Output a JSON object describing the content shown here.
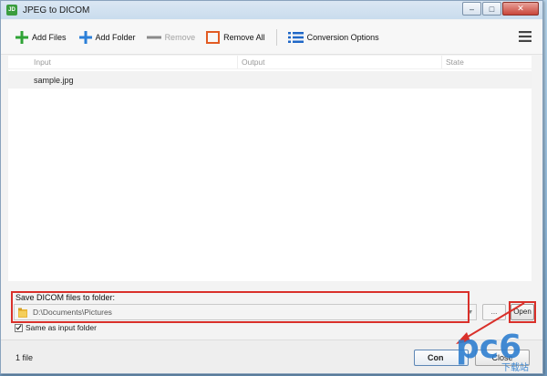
{
  "window": {
    "app_icon_text": "JD",
    "title": "JPEG to DICOM",
    "minimize_glyph": "–",
    "maximize_glyph": "□",
    "close_glyph": "✕"
  },
  "toolbar": {
    "add_files": "Add Files",
    "add_folder": "Add Folder",
    "remove": "Remove",
    "remove_all": "Remove All",
    "conversion_options": "Conversion Options",
    "colors": {
      "add_files_icon": "#2fa336",
      "add_folder_icon": "#2b7fd8",
      "remove_icon": "#8a8a8a",
      "remove_all_icon": "#e25b23",
      "options_icon": "#1f67c7"
    }
  },
  "file_list": {
    "columns": [
      "Input",
      "Output",
      "State"
    ],
    "rows": [
      {
        "input": "sample.jpg",
        "output": "",
        "state": ""
      }
    ]
  },
  "save": {
    "label": "Save DICOM files to folder:",
    "path": "D:\\Documents\\Pictures",
    "browse_label": "...",
    "open_label": "Open",
    "same_as_input_label": "Same as input folder",
    "same_as_input_checked": true
  },
  "status": {
    "file_count": "1 file",
    "convert_label": "Con",
    "close_label": "Close"
  },
  "watermark": {
    "text": "pc6",
    "subtext": "下载站",
    "color": "#2f7fd0"
  },
  "annotation_color": "#d9302a"
}
